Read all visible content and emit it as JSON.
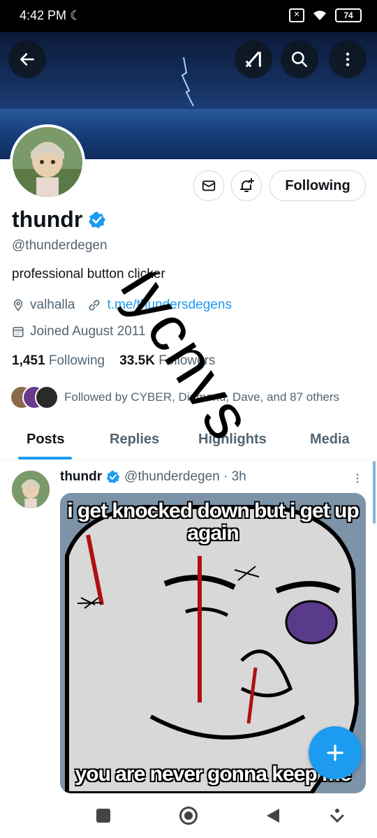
{
  "status_bar": {
    "time": "4:42 PM",
    "battery": "74"
  },
  "profile": {
    "display_name": "thundr",
    "handle": "@thunderdegen",
    "bio": "professional button clicker",
    "location": "valhalla",
    "link": "t.me/thundersdegens",
    "joined": "Joined August 2011",
    "following_count": "1,451",
    "following_label": "Following",
    "followers_count": "33.5K",
    "followers_label": "Followers",
    "followed_by": "Followed by CYBER, Diamond, Dave, and 87 others",
    "following_button": "Following"
  },
  "tabs": [
    "Posts",
    "Replies",
    "Highlights",
    "Media"
  ],
  "post": {
    "name": "thundr",
    "meta": "@thunderdegen · 3h",
    "meme_top_text": "i get knocked down but i get up again",
    "meme_bottom_text": "you are never gonna keep me"
  },
  "watermark": "lycnvs",
  "colors": {
    "accent": "#1d9bf0",
    "verified": "#1d9bf0",
    "text": "#0f1419",
    "muted": "#536471"
  },
  "icons": [
    "back-arrow-icon",
    "grok-icon",
    "search-icon",
    "more-vert-icon",
    "mail-icon",
    "bell-plus-icon",
    "verified-icon",
    "location-icon",
    "link-icon",
    "calendar-icon",
    "plus-icon"
  ]
}
